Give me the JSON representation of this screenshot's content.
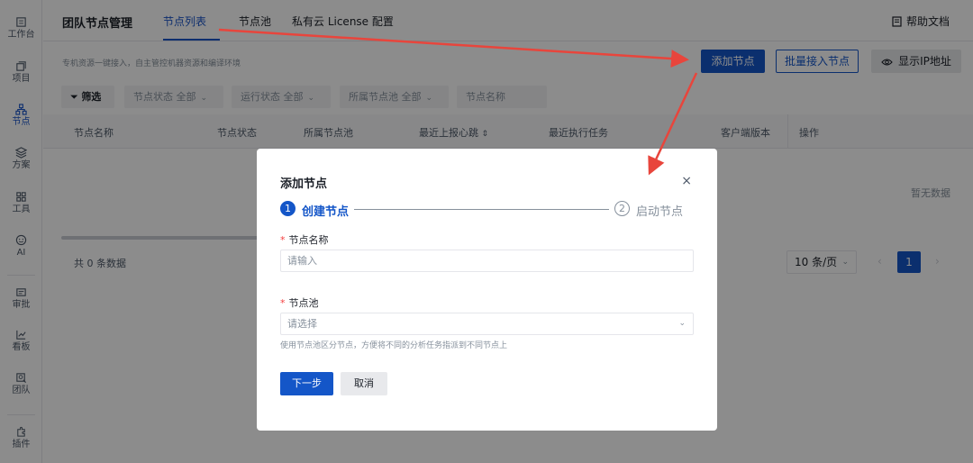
{
  "sidebar": {
    "items": [
      {
        "label": "工作台",
        "icon": "workbench-icon"
      },
      {
        "label": "项目",
        "icon": "project-icon"
      },
      {
        "label": "节点",
        "icon": "node-icon",
        "active": true
      },
      {
        "label": "方案",
        "icon": "layers-icon"
      },
      {
        "label": "工具",
        "icon": "grid-icon"
      },
      {
        "label": "AI",
        "icon": "smile-icon"
      },
      {
        "label": "审批",
        "icon": "approval-icon"
      },
      {
        "label": "看板",
        "icon": "chart-icon"
      },
      {
        "label": "团队",
        "icon": "team-icon"
      },
      {
        "label": "插件",
        "icon": "plugin-icon"
      }
    ]
  },
  "header": {
    "title": "团队节点管理",
    "tabs": [
      "节点列表",
      "节点池",
      "私有云 License 配置"
    ],
    "help": "帮助文档"
  },
  "subheader": {
    "description": "专机资源一键接入，自主管控机器资源和编译环境",
    "add_node": "添加节点",
    "batch_add": "批量接入节点",
    "show_ip": "显示IP地址"
  },
  "filters": {
    "filter_btn": "筛选",
    "node_status": "节点状态",
    "node_status_value": "全部",
    "run_status": "运行状态",
    "run_status_value": "全部",
    "pool": "所属节点池",
    "pool_value": "全部",
    "name_placeholder": "节点名称"
  },
  "table": {
    "columns": [
      "节点名称",
      "节点状态",
      "所属节点池",
      "最近上报心跳",
      "最近执行任务",
      "客户端版本",
      "操作"
    ],
    "empty": "暂无数据",
    "total": "共 0 条数据",
    "page_size": "10 条/页",
    "page": "1"
  },
  "modal": {
    "title": "添加节点",
    "close": "×",
    "steps": [
      {
        "num": "1",
        "label": "创建节点"
      },
      {
        "num": "2",
        "label": "启动节点"
      }
    ],
    "name_label": "节点名称",
    "name_placeholder": "请输入",
    "pool_label": "节点池",
    "pool_placeholder": "请选择",
    "pool_help": "使用节点池区分节点，方便将不同的分析任务指派到不同节点上",
    "next": "下一步",
    "cancel": "取消"
  },
  "colors": {
    "primary": "#1456c8",
    "annotation_arrow": "#e8453c"
  }
}
